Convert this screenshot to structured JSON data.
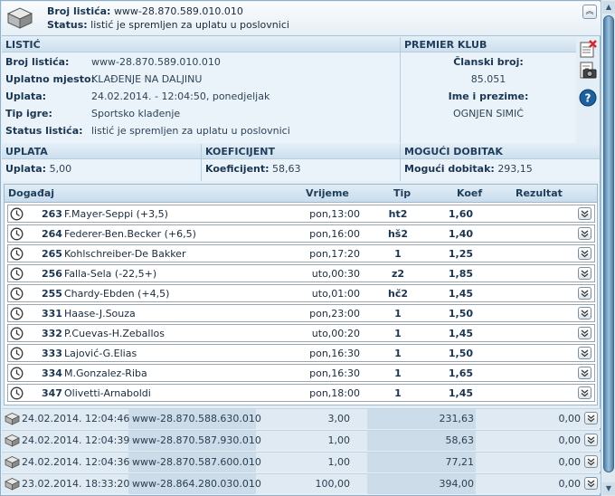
{
  "header": {
    "ticket_label": "Broj listića:",
    "ticket_value": "www-28.870.589.010.010",
    "status_label": "Status:",
    "status_value": "listić je spremljen za uplatu u poslovnici",
    "collapse_icon": "chevron-up-icon"
  },
  "listic": {
    "title": "LISTIĆ",
    "fields": [
      {
        "label": "Broj listića:",
        "value": "www-28.870.589.010.010"
      },
      {
        "label": "Uplatno mjesto:",
        "value": "KLAĐENJE NA DALJINU"
      },
      {
        "label": "Uplata:",
        "value": "24.02.2014. - 12:04:50, ponedjeljak"
      },
      {
        "label": "Tip igre:",
        "value": "Sportsko klađenje"
      },
      {
        "label": "Status listića:",
        "value": "listić je spremljen za uplatu u poslovnici"
      }
    ]
  },
  "premier": {
    "title": "PREMIER KLUB",
    "member_label": "Članski broj:",
    "member_value": "85.051",
    "name_label": "Ime i prezime:",
    "name_value": "OGNJEN SIMIĆ"
  },
  "side_icons": [
    "delete-ticket-icon",
    "camera-icon",
    "help-icon"
  ],
  "uplata": {
    "title": "UPLATA",
    "label": "Uplata:",
    "value": "5,00"
  },
  "koeficijent": {
    "title": "KOEFICIJENT",
    "label": "Koeficijent:",
    "value": "58,63"
  },
  "dobitak": {
    "title": "MOGUĆI DOBITAK",
    "label": "Mogući dobitak:",
    "value": "293,15"
  },
  "events": {
    "headers": {
      "event": "Događaj",
      "time": "Vrijeme",
      "tip": "Tip",
      "koef": "Koef",
      "result": "Rezultat"
    },
    "rows": [
      {
        "num": "263",
        "name": "F.Mayer-Seppi (+3,5)",
        "time": "pon,13:00",
        "tip": "ht2",
        "koef": "1,60"
      },
      {
        "num": "264",
        "name": "Federer-Ben.Becker (+6,5)",
        "time": "pon,16:00",
        "tip": "hš2",
        "koef": "1,40"
      },
      {
        "num": "265",
        "name": "Kohlschreiber-De Bakker",
        "time": "pon,17:20",
        "tip": "1",
        "koef": "1,25"
      },
      {
        "num": "256",
        "name": "Falla-Sela (-22,5+)",
        "time": "uto,00:30",
        "tip": "z2",
        "koef": "1,85"
      },
      {
        "num": "255",
        "name": "Chardy-Ebden (+4,5)",
        "time": "uto,01:00",
        "tip": "hč2",
        "koef": "1,45"
      },
      {
        "num": "331",
        "name": "Haase-J.Souza",
        "time": "pon,23:00",
        "tip": "1",
        "koef": "1,50"
      },
      {
        "num": "332",
        "name": "P.Cuevas-H.Zeballos",
        "time": "uto,00:20",
        "tip": "1",
        "koef": "1,45"
      },
      {
        "num": "333",
        "name": "Lajović-G.Elias",
        "time": "pon,16:30",
        "tip": "1",
        "koef": "1,50"
      },
      {
        "num": "334",
        "name": "M.Gonzalez-Riba",
        "time": "pon,16:30",
        "tip": "1",
        "koef": "1,65"
      },
      {
        "num": "347",
        "name": "Olivetti-Arnaboldi",
        "time": "pon,18:00",
        "tip": "1",
        "koef": "1,45"
      }
    ]
  },
  "history": [
    {
      "date": "24.02.2014. 12:04:46",
      "ticket": "www-28.870.588.630.010",
      "stake": "3,00",
      "win": "231,63",
      "paid": "0,00"
    },
    {
      "date": "24.02.2014. 12:04:39",
      "ticket": "www-28.870.587.930.010",
      "stake": "1,00",
      "win": "58,63",
      "paid": "0,00"
    },
    {
      "date": "24.02.2014. 12:04:36",
      "ticket": "www-28.870.587.600.010",
      "stake": "1,00",
      "win": "77,21",
      "paid": "0,00"
    },
    {
      "date": "23.02.2014. 18:33:20",
      "ticket": "www-28.864.280.030.010",
      "stake": "100,00",
      "win": "394,00",
      "paid": "0,00"
    }
  ]
}
